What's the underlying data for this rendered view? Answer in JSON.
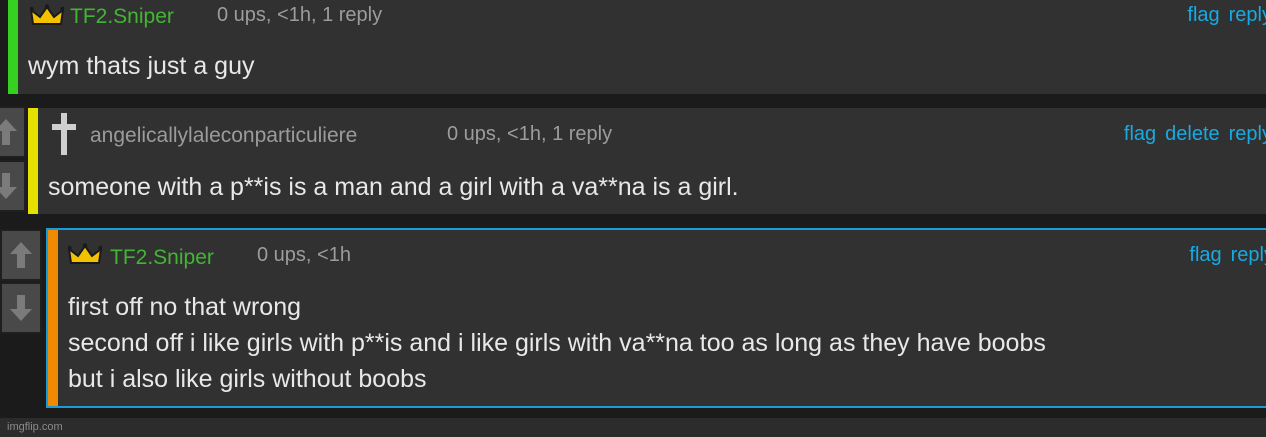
{
  "comments": [
    {
      "username": "TF2.Sniper",
      "meta": "0 ups, <1h, 1 reply",
      "actions": [
        "flag",
        "reply"
      ],
      "body": [
        "wym thats just a guy"
      ],
      "bar_color": "#36d020",
      "name_color": "#43b534",
      "badge": "crown-icon"
    },
    {
      "username": "angelicallylaleconparticuliere",
      "meta": "0 ups, <1h, 1 reply",
      "actions": [
        "flag",
        "delete",
        "reply"
      ],
      "body": [
        "someone with a p**is is a man and a girl with a va**na is a girl."
      ],
      "bar_color": "#e5e000",
      "name_color": "#9b9b9b",
      "badge": "cross-icon"
    },
    {
      "username": "TF2.Sniper",
      "meta": "0 ups, <1h",
      "actions": [
        "flag",
        "reply"
      ],
      "body": [
        "first off no that wrong",
        "second off i like girls with p**is and i like girls with va**na too as long as they have boobs",
        "but i also like girls without boobs"
      ],
      "bar_color": "#f08a00",
      "name_color": "#43b534",
      "badge": "crown-icon",
      "highlight_border": "#1e9bd7"
    }
  ],
  "watermark": "imgflip.com",
  "colors": {
    "background": "#1b1b1b",
    "panel": "#313131",
    "link": "#19a9e3",
    "meta": "#9c9c9c",
    "text": "#e8e8e8"
  }
}
